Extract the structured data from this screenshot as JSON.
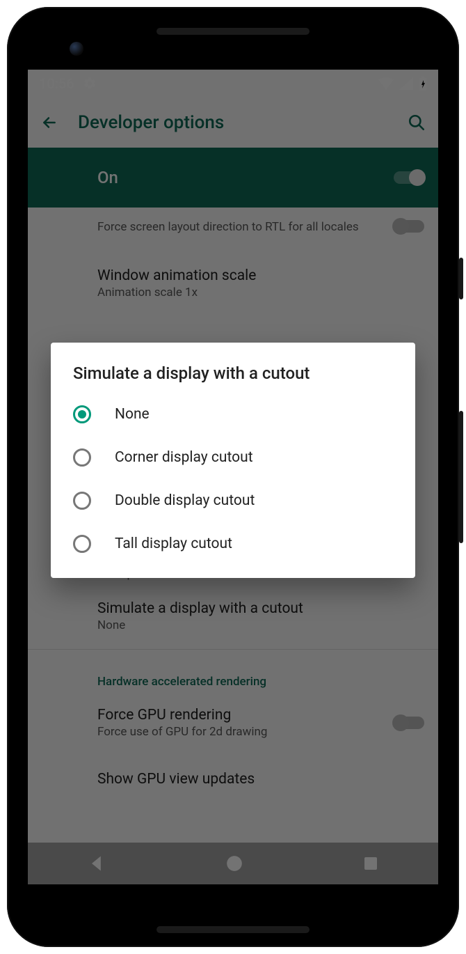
{
  "status": {
    "time": "10:56"
  },
  "appbar": {
    "title": "Developer options"
  },
  "master": {
    "label": "On"
  },
  "rows": {
    "rtl": {
      "secondary": "Force screen layout direction to RTL for all locales"
    },
    "wanim": {
      "primary": "Window animation scale",
      "secondary": "Animation scale 1x"
    },
    "swidth": {
      "secondary_fragment": "411 dp"
    },
    "cutout": {
      "primary": "Simulate a display with a cutout",
      "secondary": "None"
    },
    "section_render": "Hardware accelerated rendering",
    "gpu": {
      "primary": "Force GPU rendering",
      "secondary": "Force use of GPU for 2d drawing"
    },
    "gpu_updates": {
      "primary": "Show GPU view updates"
    }
  },
  "dialog": {
    "title": "Simulate a display with a cutout",
    "options": [
      "None",
      "Corner display cutout",
      "Double display cutout",
      "Tall display cutout"
    ],
    "selectedIndex": 0
  }
}
